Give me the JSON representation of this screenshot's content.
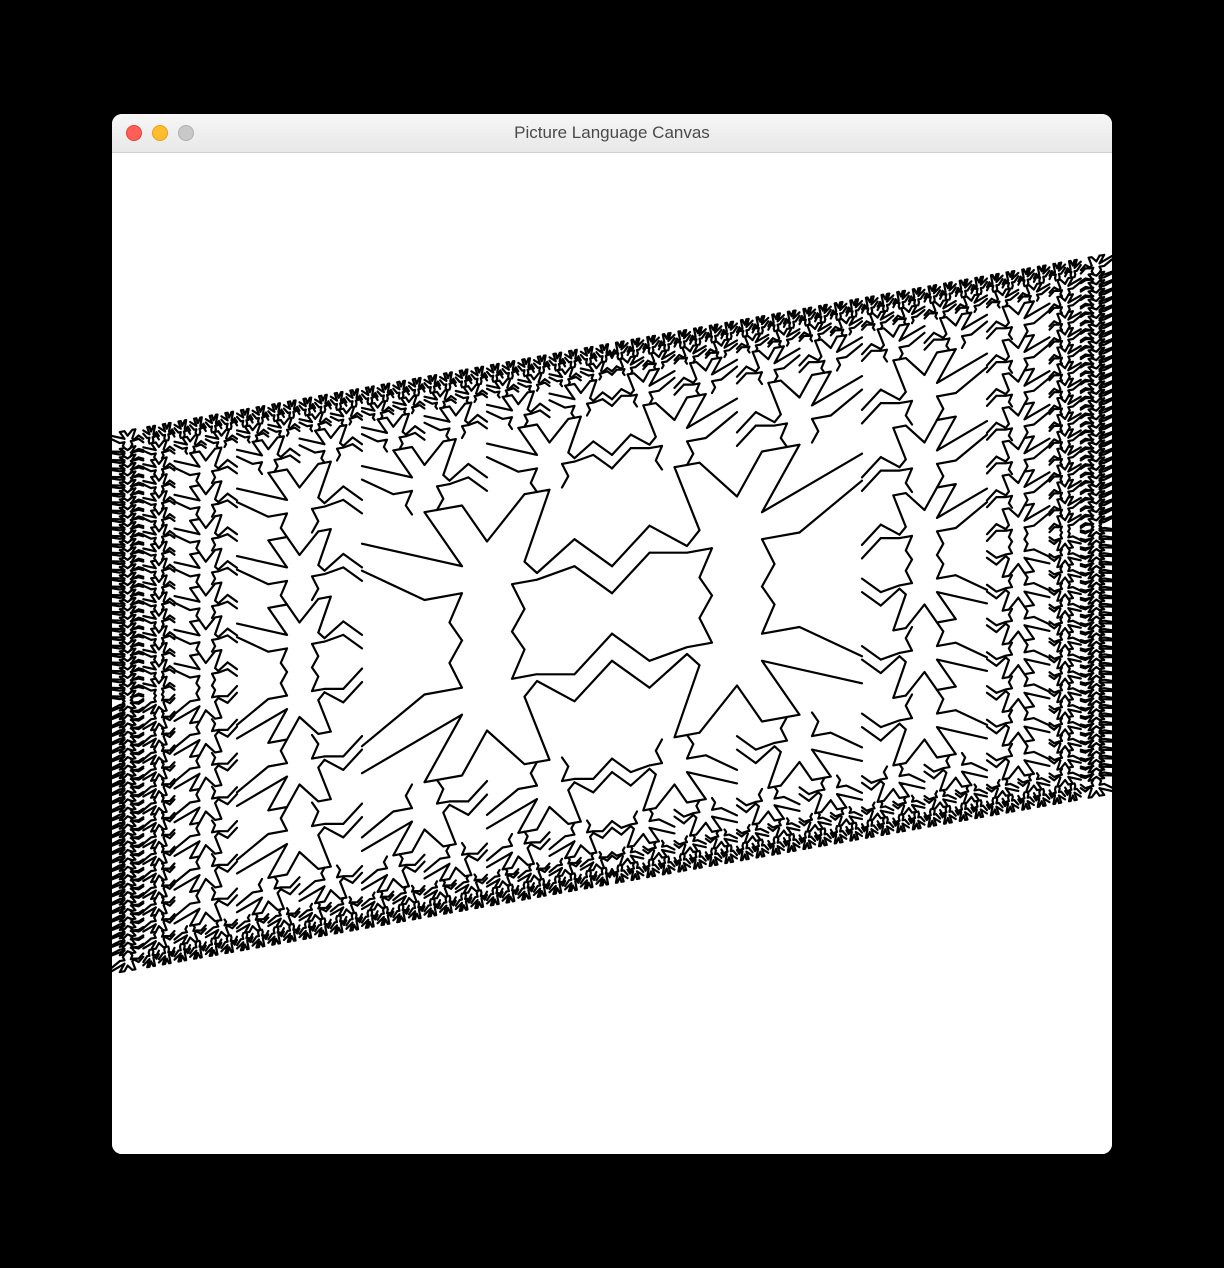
{
  "window": {
    "title": "Picture Language Canvas"
  },
  "picture": {
    "description": "SICP picture-language square-limit of a figure painter rendered in a sheared parallelogram frame",
    "depth": 4,
    "frame": {
      "origin": [
        0,
        0.82
      ],
      "edge1": [
        1.0,
        -0.18
      ],
      "edge2": [
        0.0,
        -0.54
      ]
    },
    "painter_segments_unit": [
      [
        0.0,
        0.65,
        0.15,
        0.4
      ],
      [
        0.15,
        0.4,
        0.3,
        0.6
      ],
      [
        0.3,
        0.6,
        0.35,
        0.5
      ],
      [
        0.35,
        0.5,
        0.25,
        0.0
      ],
      [
        0.25,
        0.0,
        0.35,
        0.0
      ],
      [
        0.35,
        0.0,
        0.5,
        0.3
      ],
      [
        0.5,
        0.3,
        0.6,
        0.0
      ],
      [
        0.6,
        0.0,
        0.75,
        0.0
      ],
      [
        0.75,
        0.0,
        0.6,
        0.45
      ],
      [
        0.6,
        0.45,
        1.0,
        0.15
      ],
      [
        1.0,
        0.35,
        0.75,
        0.65
      ],
      [
        0.75,
        0.65,
        0.6,
        0.65
      ],
      [
        0.6,
        0.65,
        0.65,
        0.85
      ],
      [
        0.65,
        0.85,
        0.6,
        1.0
      ],
      [
        0.4,
        1.0,
        0.35,
        0.85
      ],
      [
        0.35,
        0.85,
        0.4,
        0.65
      ],
      [
        0.4,
        0.65,
        0.3,
        0.65
      ],
      [
        0.3,
        0.65,
        0.15,
        0.6
      ],
      [
        0.15,
        0.6,
        0.0,
        0.85
      ]
    ],
    "stroke": "#000000",
    "stroke_width": 2.2
  }
}
